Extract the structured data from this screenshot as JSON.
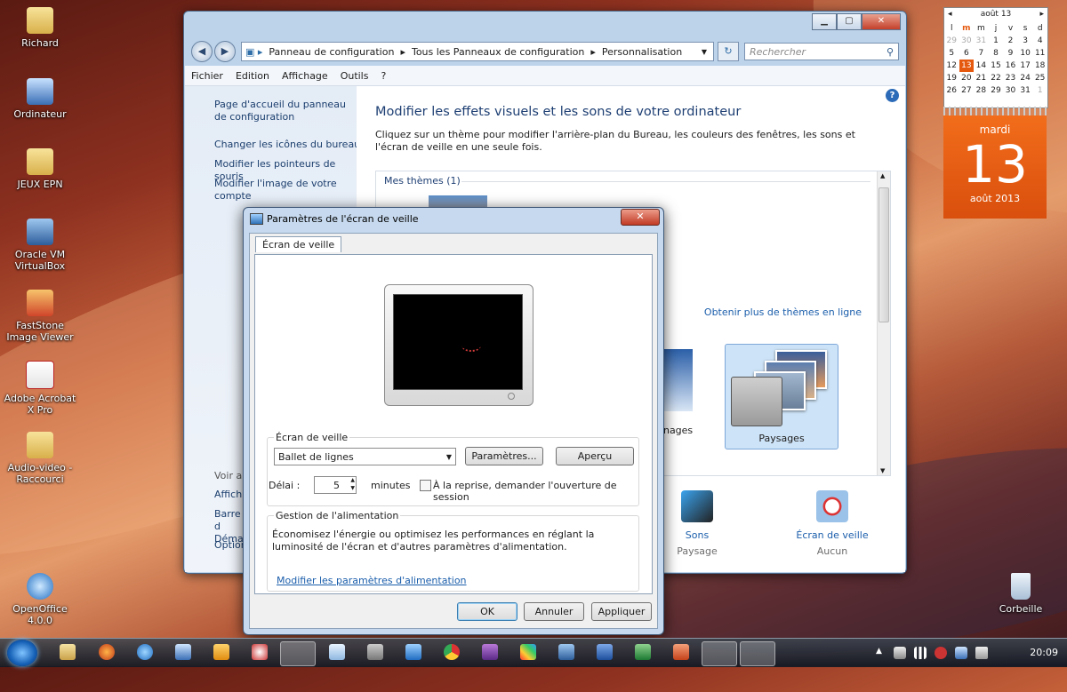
{
  "desktop": {
    "icons": [
      {
        "label": "Richard"
      },
      {
        "label": "Ordinateur"
      },
      {
        "label": "JEUX EPN"
      },
      {
        "label": "Oracle VM VirtualBox"
      },
      {
        "label": "FastStone Image Viewer"
      },
      {
        "label": "Adobe Acrobat X Pro"
      },
      {
        "label": "Audio-video - Raccourci"
      },
      {
        "label": "OpenOffice 4.0.0"
      },
      {
        "label": "Corbeille"
      }
    ]
  },
  "explorer": {
    "breadcrumb": [
      "Panneau de configuration",
      "Tous les Panneaux de configuration",
      "Personnalisation"
    ],
    "search_placeholder": "Rechercher",
    "menu": [
      "Fichier",
      "Edition",
      "Affichage",
      "Outils",
      "?"
    ],
    "nav": {
      "home": "Page d'accueil du panneau de configuration",
      "links": [
        "Changer les icônes du bureau",
        "Modifier les pointeurs de souris",
        "Modifier l'image de votre compte"
      ],
      "see_also_partial": [
        "Voir au",
        "Affich",
        "Barre d Démar",
        "Option"
      ]
    },
    "title": "Modifier les effets visuels et les sons de votre ordinateur",
    "description": "Cliquez sur un thème pour modifier l'arrière-plan du Bureau, les couleurs des fenêtres, les sons et l'écran de veille en une seule fois.",
    "my_themes": "Mes thèmes (1)",
    "get_more": "Obtenir plus de thèmes en ligne",
    "theme_partial_label": "nnages",
    "theme_selected_label": "Paysages",
    "bottom": [
      {
        "label": "Sons",
        "value": "Paysage"
      },
      {
        "label": "Écran de veille",
        "value": "Aucun"
      }
    ]
  },
  "dialog": {
    "title": "Paramètres de l'écran de veille",
    "tab": "Écran de veille",
    "screensaver_group": "Écran de veille",
    "screensaver_value": "Ballet de lignes",
    "settings_button": "Paramètres...",
    "preview_button": "Aperçu",
    "delay_label": "Délai :",
    "delay_value": "5",
    "minutes_label": "minutes",
    "resume_label": "À la reprise, demander l'ouverture de session",
    "power_group": "Gestion de l'alimentation",
    "power_text": "Économisez l'énergie ou optimisez les performances en réglant la luminosité de l'écran et d'autres paramètres d'alimentation.",
    "power_link": "Modifier les paramètres d'alimentation",
    "ok": "OK",
    "cancel": "Annuler",
    "apply": "Appliquer"
  },
  "calendar": {
    "month_header": "août 13",
    "day_headers": [
      "l",
      "m",
      "m",
      "j",
      "v",
      "s",
      "d"
    ],
    "weeks": [
      [
        "29",
        "30",
        "31",
        "1",
        "2",
        "3",
        "4"
      ],
      [
        "5",
        "6",
        "7",
        "8",
        "9",
        "10",
        "11"
      ],
      [
        "12",
        "13",
        "14",
        "15",
        "16",
        "17",
        "18"
      ],
      [
        "19",
        "20",
        "21",
        "22",
        "23",
        "24",
        "25"
      ],
      [
        "26",
        "27",
        "28",
        "29",
        "30",
        "31",
        "1"
      ]
    ],
    "weekday": "mardi",
    "day": "13",
    "month_year": "août 2013"
  },
  "taskbar": {
    "time": "20:09"
  },
  "colors": {
    "accent": "#1e3f73",
    "link": "#1b5eab",
    "calendar_orange": "#e5590f"
  }
}
